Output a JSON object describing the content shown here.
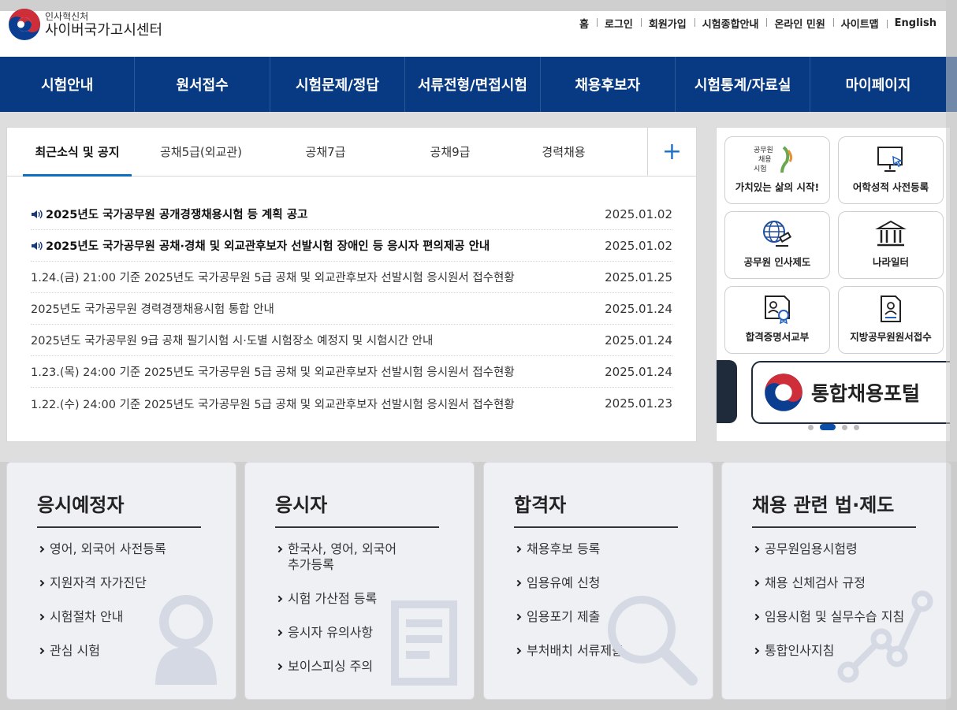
{
  "header": {
    "logo_sub": "인사혁신처",
    "logo_main": "사이버국가고시센터",
    "util_links": [
      "홈",
      "로그인",
      "회원가입",
      "시험종합안내",
      "온라인 민원",
      "사이트맵",
      "English"
    ]
  },
  "gnb": [
    "시험안내",
    "원서접수",
    "시험문제/정답",
    "서류전형/면접시험",
    "채용후보자",
    "시험통계/자료실",
    "마이페이지"
  ],
  "news": {
    "tabs": [
      "최근소식 및 공지",
      "공채5급(외교관)",
      "공채7급",
      "공채9급",
      "경력채용"
    ],
    "more_icon": "+",
    "items": [
      {
        "title": "2025년도 국가공무원 공개경쟁채용시험 등 계획 공고",
        "date": "2025.01.02"
      },
      {
        "title": "2025년도 국가공무원 공채·경채 및 외교관후보자 선발시험 장애인 등 응시자 편의제공 안내",
        "date": "2025.01.02"
      },
      {
        "title": "1.24.(금) 21:00 기준 2025년도 국가공무원 5급 공채 및 외교관후보자 선발시험 응시원서 접수현황",
        "date": "2025.01.25"
      },
      {
        "title": "2025년도 국가공무원 경력경쟁채용시험 통합 안내",
        "date": "2025.01.24"
      },
      {
        "title": "2025년도 국가공무원 9급 공채 필기시험 시·도별 시험장소 예정지 및 시험시간 안내",
        "date": "2025.01.24"
      },
      {
        "title": "1.23.(목) 24:00 기준 2025년도 국가공무원 5급 공채 및 외교관후보자 선발시험 응시원서 접수현황",
        "date": "2025.01.24"
      },
      {
        "title": "1.22.(수) 24:00 기준 2025년도 국가공무원 5급 공채 및 외교관후보자 선발시험 응시원서 접수현황",
        "date": "2025.01.23"
      }
    ]
  },
  "quick": {
    "items": [
      {
        "label": "가치있는 삶의 시작!",
        "icon": "exam-logo-icon"
      },
      {
        "label": "어학성적 사전등록",
        "icon": "monitor-cursor-icon"
      },
      {
        "label": "공무원 인사제도",
        "icon": "globe-gavel-icon"
      },
      {
        "label": "나라일터",
        "icon": "government-building-icon"
      },
      {
        "label": "합격증명서교부",
        "icon": "certificate-icon"
      },
      {
        "label": "지방공무원원서접수",
        "icon": "document-person-icon"
      }
    ],
    "exam_logo_text": "공무원 채용 시험",
    "banner_text": "통합채용포털"
  },
  "cards": [
    {
      "title": "응시예정자",
      "items": [
        "영어, 외국어 사전등록",
        "지원자격 자가진단",
        "시험절차 안내",
        "관심 시험"
      ]
    },
    {
      "title": "응시자",
      "items": [
        "한국사, 영어, 외국어\n추가등록",
        "시험 가산점 등록",
        "응시자 유의사항",
        "보이스피싱 주의"
      ]
    },
    {
      "title": "합격자",
      "items": [
        "채용후보 등록",
        "임용유예 신청",
        "임용포기 제출",
        "부처배치 서류제출"
      ]
    },
    {
      "title": "채용 관련 법·제도",
      "items": [
        "공무원임용시험령",
        "채용 신체검사 규정",
        "임용시험 및 실무수습 지침",
        "통합인사지침"
      ]
    }
  ],
  "colors": {
    "gnb": "#073a82",
    "accent": "#0a6fc2"
  }
}
